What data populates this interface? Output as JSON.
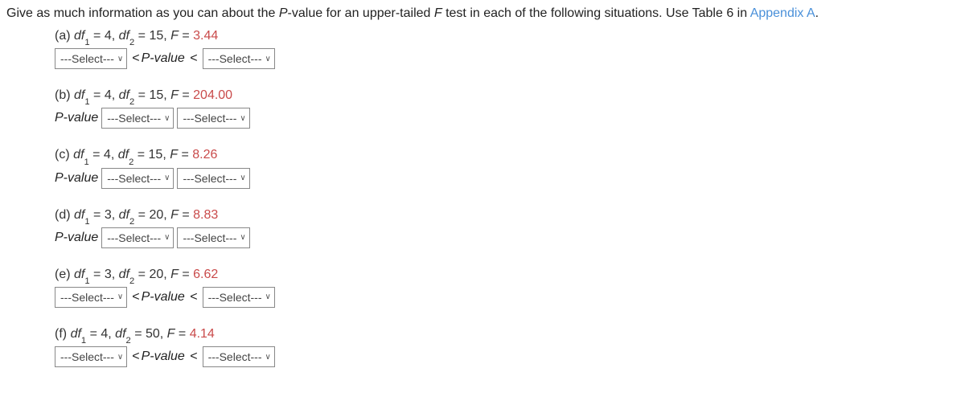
{
  "intro": {
    "text_part1": "Give as much information as you can about the ",
    "pvalue_ital": "P",
    "text_part2": "-value for an upper-tailed ",
    "f_ital": "F",
    "text_part3": " test in each of the following situations. Use Table 6 in ",
    "appendix_link": "Appendix A",
    "period": "."
  },
  "select_placeholder": "---Select---",
  "labels": {
    "df": "df",
    "F_eq": "F",
    "Pvalue": "P-value",
    "lt": "<",
    "P_value_lt": "P-value"
  },
  "problems": [
    {
      "part": "(a)",
      "df1": "4",
      "df2": "15",
      "F": "3.44",
      "layout": "range"
    },
    {
      "part": "(b)",
      "df1": "4",
      "df2": "15",
      "F": "204.00",
      "layout": "pvalue_first"
    },
    {
      "part": "(c)",
      "df1": "4",
      "df2": "15",
      "F": "8.26",
      "layout": "pvalue_first"
    },
    {
      "part": "(d)",
      "df1": "3",
      "df2": "20",
      "F": "8.83",
      "layout": "pvalue_first"
    },
    {
      "part": "(e)",
      "df1": "3",
      "df2": "20",
      "F": "6.62",
      "layout": "range"
    },
    {
      "part": "(f)",
      "df1": "4",
      "df2": "50",
      "F": "4.14",
      "layout": "range"
    }
  ]
}
